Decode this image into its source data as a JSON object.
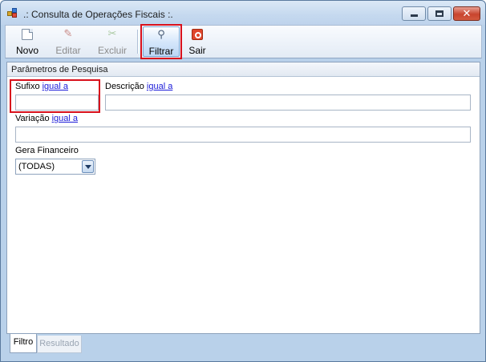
{
  "window": {
    "title": ".: Consulta de Operações Fiscais :.",
    "close_glyph": "✕"
  },
  "toolbar": {
    "novo_label": "Novo",
    "editar_label": "Editar",
    "excluir_label": "Excluir",
    "filtrar_label": "Filtrar",
    "sair_label": "Sair"
  },
  "params": {
    "section_title": "Parâmetros de Pesquisa",
    "sufixo": {
      "label": "Sufixo",
      "operator": "igual a",
      "value": ""
    },
    "descricao": {
      "label": "Descrição",
      "operator": "igual a",
      "value": ""
    },
    "variacao": {
      "label": "Variação",
      "operator": "igual a",
      "value": ""
    },
    "gera_financeiro": {
      "label": "Gera Financeiro",
      "selected": "(TODAS)"
    }
  },
  "tabs": {
    "filtro": "Filtro",
    "resultado": "Resultado"
  },
  "colors": {
    "highlight": "#d8101c",
    "link": "#1a1ad8",
    "window_frame": "#b9d1ea"
  }
}
